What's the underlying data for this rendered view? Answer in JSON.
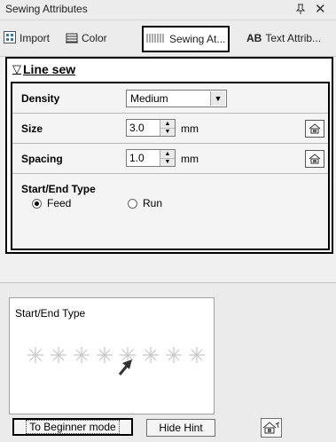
{
  "window": {
    "title": "Sewing Attributes",
    "pin_glyph": "ᵖ",
    "close_glyph": "✕"
  },
  "tabs": [
    {
      "label": "Import",
      "icon": "import-icon"
    },
    {
      "label": "Color",
      "icon": "color-icon"
    },
    {
      "label": "Sewing At...",
      "icon": "sewing-icon",
      "active": true
    },
    {
      "label": "Text Attrib...",
      "icon_text": "AB"
    }
  ],
  "section": {
    "title": "Line sew",
    "toggle_glyph": "▽"
  },
  "attributes": {
    "density": {
      "label": "Density",
      "value": "Medium"
    },
    "size": {
      "label": "Size",
      "value": "3.0",
      "unit": "mm"
    },
    "spacing": {
      "label": "Spacing",
      "value": "1.0",
      "unit": "mm"
    },
    "start_end_type": {
      "label": "Start/End Type",
      "options": [
        {
          "label": "Feed",
          "selected": true
        },
        {
          "label": "Run",
          "selected": false
        }
      ]
    }
  },
  "hint": {
    "title": "Start/End Type"
  },
  "footer": {
    "beginner_label": "To Beginner mode",
    "hide_hint_label": "Hide Hint"
  },
  "colors": {
    "accent_border": "#000000",
    "panel_bg": "#ffffff",
    "window_bg": "#f0f0f0",
    "stitch": "#c8c8c8",
    "arrow": "#333333"
  }
}
